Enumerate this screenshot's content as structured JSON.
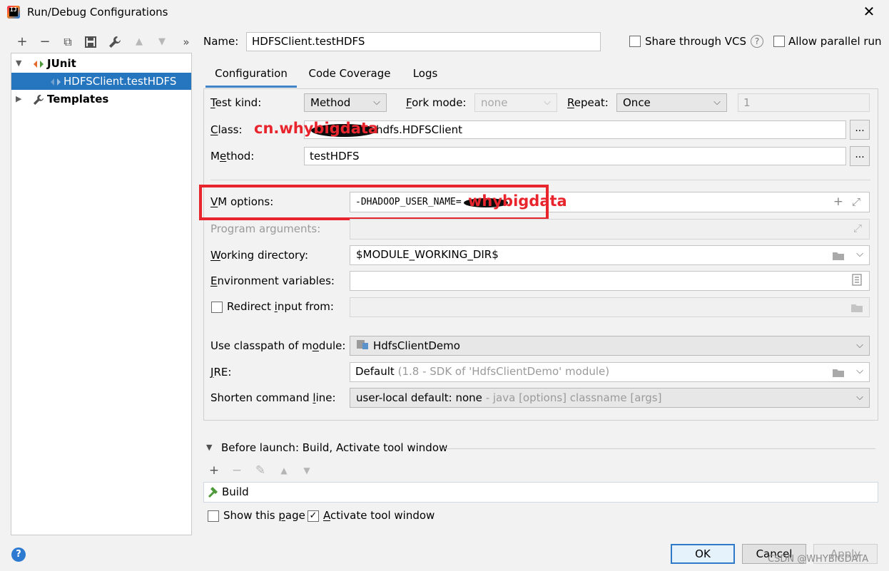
{
  "window": {
    "title": "Run/Debug Configurations",
    "close_glyph": "✕"
  },
  "toolbar": {
    "add": "+",
    "remove": "−",
    "copy": "⧉",
    "save": "💾",
    "edit": "🔧",
    "up": "▲",
    "down": "▼",
    "more": "»"
  },
  "tree": {
    "junit_label": "JUnit",
    "config_label": "HDFSClient.testHDFS",
    "templates_label": "Templates"
  },
  "header": {
    "name_label": "Name:",
    "name_value": "HDFSClient.testHDFS",
    "share_vcs_label": "Share through VCS",
    "share_vcs_checked": false,
    "help_glyph": "?",
    "parallel_label": "Allow parallel run",
    "parallel_checked": false
  },
  "tabs": [
    {
      "label": "Configuration",
      "active": true
    },
    {
      "label": "Code Coverage",
      "active": false
    },
    {
      "label": "Logs",
      "active": false
    }
  ],
  "config": {
    "test_kind_label": "Test kind:",
    "test_kind_value": "Method",
    "fork_mode_label": "Fork mode:",
    "fork_mode_value": "none",
    "repeat_label": "Repeat:",
    "repeat_value": "Once",
    "repeat_count": "1",
    "class_label": "Class:",
    "class_value": "hdfs.HDFSClient",
    "method_label": "Method:",
    "method_value": "testHDFS",
    "browse_glyph": "...",
    "vm_options_label": "VM options:",
    "vm_options_value": "-DHADOOP_USER_NAME=",
    "program_args_label": "Program arguments:",
    "program_args_value": "",
    "working_dir_label": "Working directory:",
    "working_dir_value": "$MODULE_WORKING_DIR$",
    "env_vars_label": "Environment variables:",
    "env_vars_value": "",
    "redirect_label": "Redirect input from:",
    "redirect_checked": false,
    "classpath_label": "Use classpath of module:",
    "classpath_value": "HdfsClientDemo",
    "jre_label": "JRE:",
    "jre_value": "Default",
    "jre_hint": "(1.8 - SDK of 'HdfsClientDemo' module)",
    "shorten_label": "Shorten command line:",
    "shorten_value": "user-local default: none",
    "shorten_hint": "- java [options] classname [args]"
  },
  "annotations": {
    "class_overlay": "cn.whybigdata",
    "vm_overlay": "whybigdata",
    "color": "#e8242c"
  },
  "before_launch": {
    "label": "Before launch: Build, Activate tool window",
    "add": "+",
    "remove": "−",
    "edit": "✎",
    "up": "▲",
    "down": "▼",
    "task": "Build",
    "show_page_label": "Show this page",
    "show_page_checked": false,
    "activate_label": "Activate tool window",
    "activate_checked": true
  },
  "footer": {
    "help_glyph": "?",
    "ok_label": "OK",
    "cancel_label": "Cancel",
    "apply_label": "Apply",
    "watermark": "CSDN @WHYBIGDATA"
  }
}
